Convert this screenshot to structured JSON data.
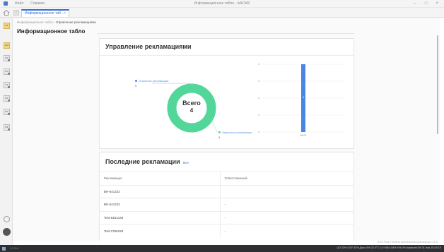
{
  "window": {
    "menu": [
      "Файл",
      "Справка"
    ],
    "title": "Информационное табло - isACMS"
  },
  "tab": {
    "label": "Информационное таб...",
    "close": "×"
  },
  "sidebar": {
    "items": [
      {
        "label": "ИТ",
        "active": true
      },
      {
        "label": "МО",
        "active": true
      },
      {
        "label": "ИР"
      },
      {
        "label": "МЛ"
      },
      {
        "label": "СК"
      },
      {
        "label": "ИР"
      },
      {
        "label": "МС"
      },
      {
        "label": "МР"
      }
    ]
  },
  "breadcrumb": {
    "root": "Информационное табло",
    "sep": "/",
    "current": "Управление рекламациями"
  },
  "page_title": "Информационное табло",
  "complaints": {
    "title": "Управление рекламациями",
    "open_label": "Открытые рекламации",
    "open_value": "0",
    "closed_label": "Закрытые рекламации",
    "closed_value": "4",
    "total_label": "Всего",
    "total_value": "4"
  },
  "chart_data": [
    {
      "type": "pie",
      "categories": [
        "Открытые рекламации",
        "Закрытые рекламации"
      ],
      "values": [
        0,
        4
      ],
      "center_text": [
        "Всего",
        "4"
      ],
      "colors": [
        "#4a86e8",
        "#52d69a"
      ]
    },
    {
      "type": "bar",
      "categories": [
        "08.04"
      ],
      "values": [
        4
      ],
      "ylim": [
        0,
        4
      ],
      "yticks": [
        0,
        1,
        2,
        3,
        4
      ],
      "data_labels": [
        "4"
      ],
      "color": "#4a86e8",
      "grid": true
    }
  ],
  "recent": {
    "title": "Последние рекламации",
    "all_link": "Все",
    "columns": [
      "Рекламация",
      "Ответственный"
    ],
    "rows": [
      [
        "ВН-641222",
        ""
      ],
      [
        "ВН-641222",
        "-"
      ],
      [
        "Test-8154130",
        "-"
      ],
      [
        "Test-2766225",
        "-"
      ]
    ]
  },
  "footer": "ООО Рога и Копыта  isacms.kontur.local  версия: 0.4.11",
  "taskbar": {
    "desktops": "1 2 3 4",
    "status": "ЦП 23%  ОЗУ 32%  Диск 0%  22.0°C  0.0 МБ/с  84%  0%  0%  balanced  Вт 01 ноя 15:34:19"
  }
}
